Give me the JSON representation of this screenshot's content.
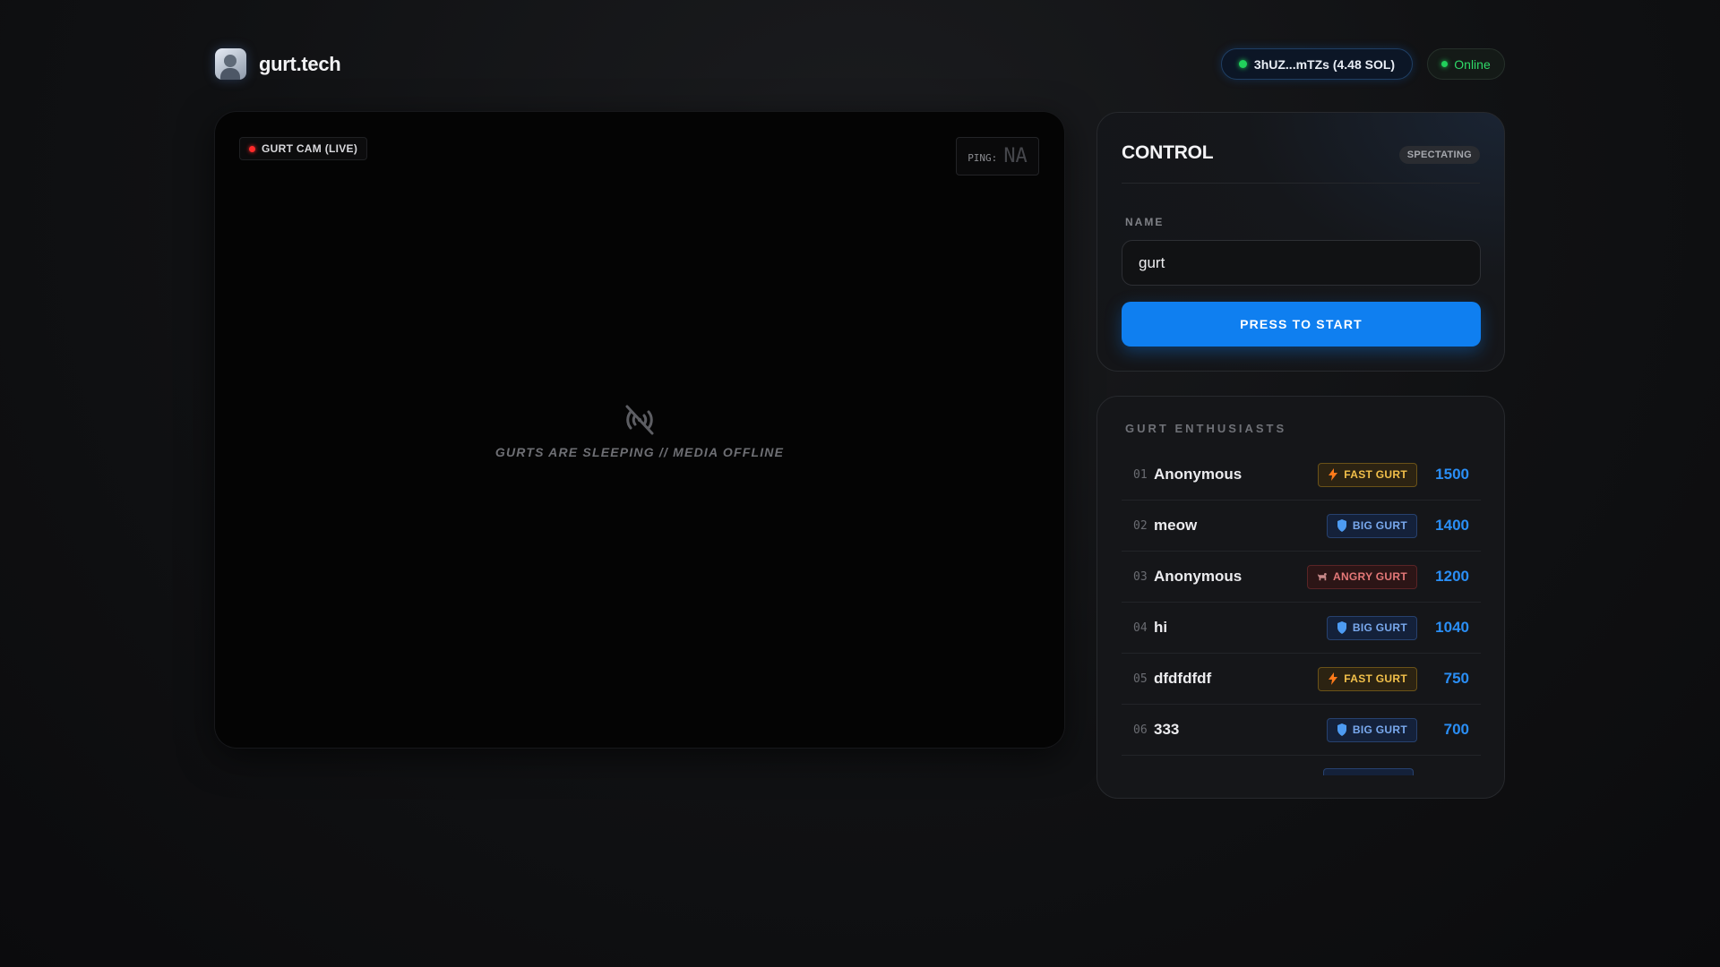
{
  "header": {
    "brand_name": "gurt.tech",
    "wallet_label": "3hUZ...mTZs (4.48 SOL)",
    "status_label": "Online"
  },
  "video": {
    "cam_label": "GURT CAM (LIVE)",
    "ping_label": "PING:",
    "ping_value": "NA",
    "offline_message": "GURTS ARE SLEEPING // MEDIA OFFLINE",
    "offline_icon": "signal-off-icon"
  },
  "control": {
    "title": "CONTROL",
    "mode_badge": "SPECTATING",
    "name_label": "NAME",
    "name_value": "gurt",
    "start_label": "PRESS TO START"
  },
  "leaderboard": {
    "title": "GURT ENTHUSIASTS",
    "rows": [
      {
        "rank": "01",
        "name": "Anonymous",
        "badge": "FAST GURT",
        "badge_type": "fast",
        "score": "1500"
      },
      {
        "rank": "02",
        "name": "meow",
        "badge": "BIG GURT",
        "badge_type": "big",
        "score": "1400"
      },
      {
        "rank": "03",
        "name": "Anonymous",
        "badge": "ANGRY GURT",
        "badge_type": "angry",
        "score": "1200"
      },
      {
        "rank": "04",
        "name": "hi",
        "badge": "BIG GURT",
        "badge_type": "big",
        "score": "1040"
      },
      {
        "rank": "05",
        "name": "dfdfdfdf",
        "badge": "FAST GURT",
        "badge_type": "fast",
        "score": "750"
      },
      {
        "rank": "06",
        "name": "333",
        "badge": "BIG GURT",
        "badge_type": "big",
        "score": "700"
      }
    ]
  },
  "colors": {
    "accent": "#0f7ff0",
    "online": "#21d15b",
    "live": "#ff2a2a",
    "score": "#2a8ef5"
  }
}
